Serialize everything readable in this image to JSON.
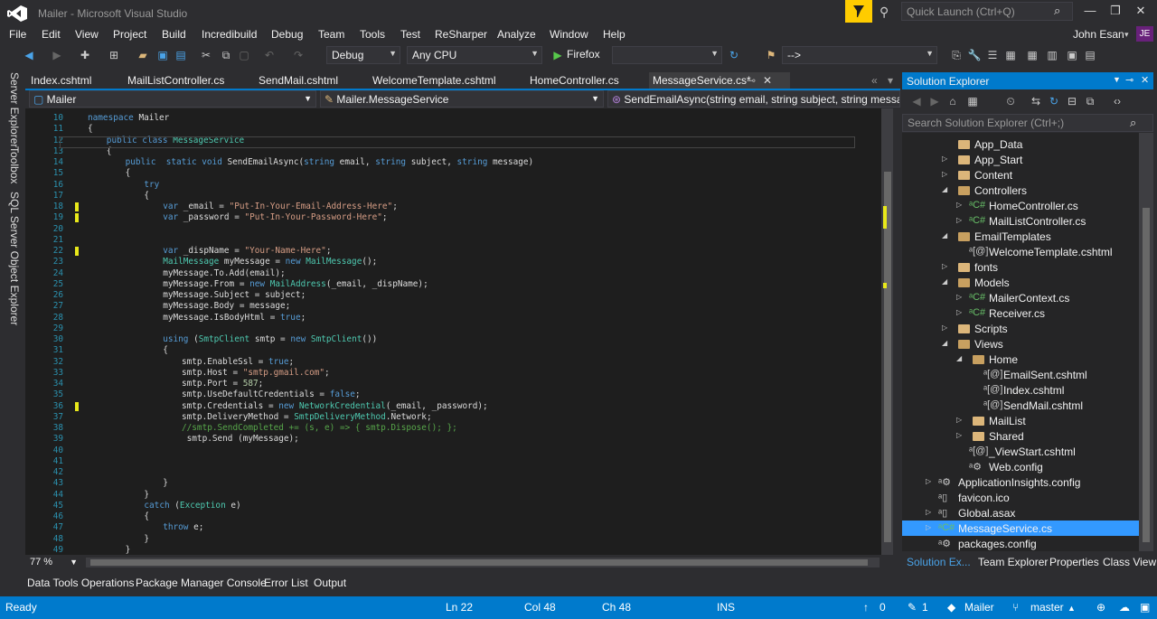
{
  "window": {
    "title": "Mailer - Microsoft Visual Studio",
    "quick_launch_placeholder": "Quick Launch (Ctrl+Q)",
    "user": "John Esan",
    "avatar_initials": "JE"
  },
  "menu": [
    "File",
    "Edit",
    "View",
    "Project",
    "Build",
    "Incredibuild",
    "Debug",
    "Team",
    "Tools",
    "Test",
    "ReSharper",
    "Analyze",
    "Window",
    "Help"
  ],
  "toolbar": {
    "config": "Debug",
    "platform": "Any CPU",
    "run_target": "Firefox",
    "nav_combo": "-->"
  },
  "left_tool_tabs": [
    "Server Explorer",
    "Toolbox",
    "SQL Server Object Explorer"
  ],
  "doc_tabs": [
    "Index.cshtml",
    "MailListController.cs",
    "SendMail.cshtml",
    "WelcomeTemplate.cshtml",
    "HomeController.cs",
    "MessageService.cs*"
  ],
  "nav": {
    "project": "Mailer",
    "type": "Mailer.MessageService",
    "member": "SendEmailAsync(string email, string subject, string messa"
  },
  "editor": {
    "line_numbers": [
      "10",
      "11",
      "12",
      "13",
      "14",
      "15",
      "16",
      "17",
      "18",
      "19",
      "20",
      "21",
      "22",
      "23",
      "24",
      "25",
      "26",
      "27",
      "28",
      "29",
      "30",
      "31",
      "32",
      "33",
      "34",
      "35",
      "36",
      "37",
      "38",
      "39",
      "40",
      "41",
      "42",
      "43",
      "44",
      "45",
      "46",
      "47",
      "48",
      "49"
    ],
    "zoom": "77 %"
  },
  "bottom_tabs": [
    "Data Tools Operations",
    "Package Manager Console",
    "Error List",
    "Output"
  ],
  "status": {
    "state": "Ready",
    "ln": "Ln 22",
    "col": "Col 48",
    "ch": "Ch 48",
    "mode": "INS",
    "pushes": "0",
    "changes": "1",
    "repo": "Mailer",
    "branch": "master"
  },
  "solution_explorer": {
    "title": "Solution Explorer",
    "search_placeholder": "Search Solution Explorer (Ctrl+;)",
    "nodes": [
      {
        "label": "App_Data",
        "kind": "folder",
        "depth": 0,
        "expand": ""
      },
      {
        "label": "App_Start",
        "kind": "folder",
        "depth": 0,
        "expand": "collapsed"
      },
      {
        "label": "Content",
        "kind": "folder",
        "depth": 0,
        "expand": "collapsed"
      },
      {
        "label": "Controllers",
        "kind": "folder-open",
        "depth": 0,
        "expand": "expanded"
      },
      {
        "label": "HomeController.cs",
        "kind": "cs",
        "depth": 1,
        "expand": "collapsed"
      },
      {
        "label": "MailListController.cs",
        "kind": "cs",
        "depth": 1,
        "expand": "collapsed"
      },
      {
        "label": "EmailTemplates",
        "kind": "folder-open",
        "depth": 0,
        "expand": "expanded"
      },
      {
        "label": "WelcomeTemplate.cshtml",
        "kind": "cshtml",
        "depth": 1,
        "expand": ""
      },
      {
        "label": "fonts",
        "kind": "folder",
        "depth": 0,
        "expand": "collapsed"
      },
      {
        "label": "Models",
        "kind": "folder-open",
        "depth": 0,
        "expand": "expanded"
      },
      {
        "label": "MailerContext.cs",
        "kind": "cs",
        "depth": 1,
        "expand": "collapsed"
      },
      {
        "label": "Receiver.cs",
        "kind": "cs",
        "depth": 1,
        "expand": "collapsed"
      },
      {
        "label": "Scripts",
        "kind": "folder",
        "depth": 0,
        "expand": "collapsed"
      },
      {
        "label": "Views",
        "kind": "folder-open",
        "depth": 0,
        "expand": "expanded"
      },
      {
        "label": "Home",
        "kind": "folder-open",
        "depth": 1,
        "expand": "expanded"
      },
      {
        "label": "EmailSent.cshtml",
        "kind": "cshtml",
        "depth": 2,
        "expand": ""
      },
      {
        "label": "Index.cshtml",
        "kind": "cshtml",
        "depth": 2,
        "expand": ""
      },
      {
        "label": "SendMail.cshtml",
        "kind": "cshtml",
        "depth": 2,
        "expand": ""
      },
      {
        "label": "MailList",
        "kind": "folder",
        "depth": 1,
        "expand": "collapsed"
      },
      {
        "label": "Shared",
        "kind": "folder",
        "depth": 1,
        "expand": "collapsed"
      },
      {
        "label": "_ViewStart.cshtml",
        "kind": "cshtml",
        "depth": 1,
        "expand": ""
      },
      {
        "label": "Web.config",
        "kind": "config",
        "depth": 1,
        "expand": ""
      },
      {
        "label": "ApplicationInsights.config",
        "kind": "config",
        "depth": -1,
        "expand": "collapsed"
      },
      {
        "label": "favicon.ico",
        "kind": "file",
        "depth": -1,
        "expand": ""
      },
      {
        "label": "Global.asax",
        "kind": "file",
        "depth": -1,
        "expand": "collapsed"
      },
      {
        "label": "MessageService.cs",
        "kind": "cs",
        "depth": -1,
        "expand": "collapsed"
      },
      {
        "label": "packages.config",
        "kind": "config",
        "depth": -1,
        "expand": ""
      }
    ],
    "tabs": [
      "Solution Ex...",
      "Team Explorer",
      "Properties",
      "Class View"
    ]
  },
  "colors": {
    "accent": "#007acc",
    "background": "#2d2d30",
    "editor": "#1e1e1e",
    "selection": "#3399ff"
  }
}
